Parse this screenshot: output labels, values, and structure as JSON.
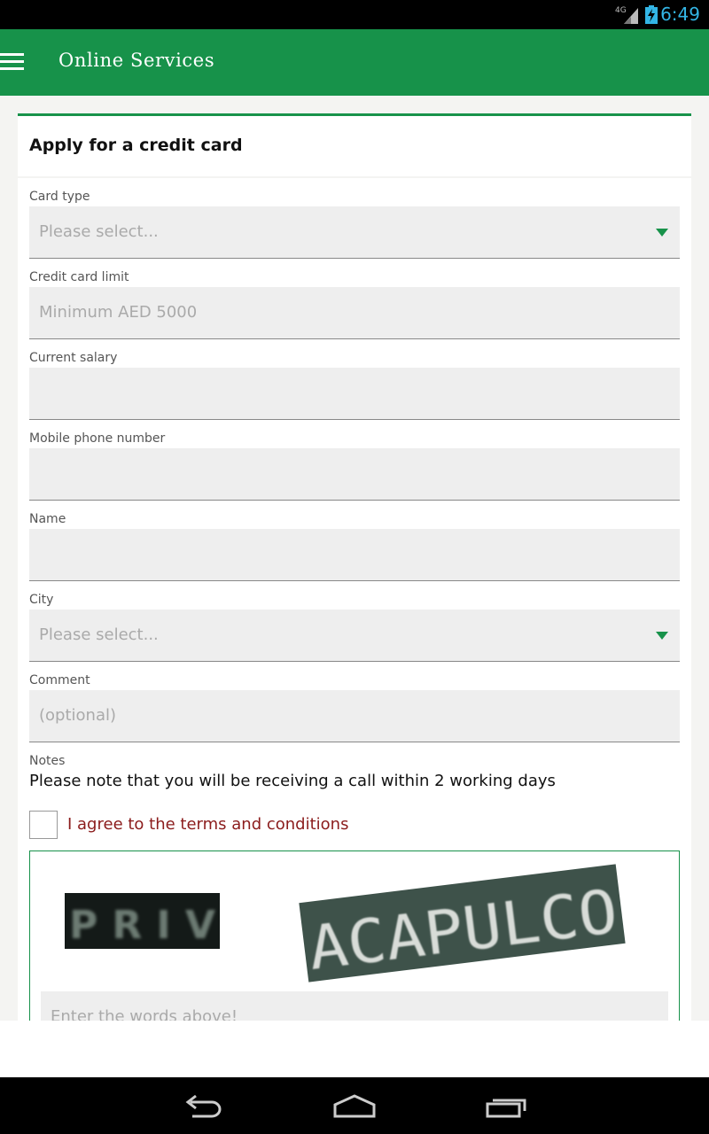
{
  "status": {
    "time": "6:49",
    "network": "4G"
  },
  "appbar": {
    "title": "Online Services"
  },
  "form": {
    "heading": "Apply for a credit card",
    "fields": [
      {
        "label": "Card type",
        "placeholder": "Please select...",
        "type": "select"
      },
      {
        "label": "Credit card limit",
        "placeholder": "Minimum AED 5000",
        "type": "text"
      },
      {
        "label": "Current salary",
        "placeholder": "",
        "type": "text"
      },
      {
        "label": "Mobile phone number",
        "placeholder": "",
        "type": "text"
      },
      {
        "label": "Name",
        "placeholder": "",
        "type": "text"
      },
      {
        "label": "City",
        "placeholder": "Please select...",
        "type": "select"
      },
      {
        "label": "Comment",
        "placeholder": "(optional)",
        "type": "text"
      }
    ],
    "notes_label": "Notes",
    "notes_text": "Please note that you will be receiving a call within 2 working days",
    "agree_label": "I agree to the terms and conditions",
    "agree_checked": false
  },
  "captcha": {
    "word1": "PRIV",
    "word2": "ACAPULCO",
    "input_placeholder": "Enter the words above!"
  },
  "colors": {
    "accent": "#17924a",
    "agree_text": "#8b1c1c",
    "status_text": "#33b5e5"
  },
  "icons": {
    "menu": "hamburger-menu-icon",
    "back": "back-icon",
    "home": "home-icon",
    "recents": "recents-icon"
  }
}
